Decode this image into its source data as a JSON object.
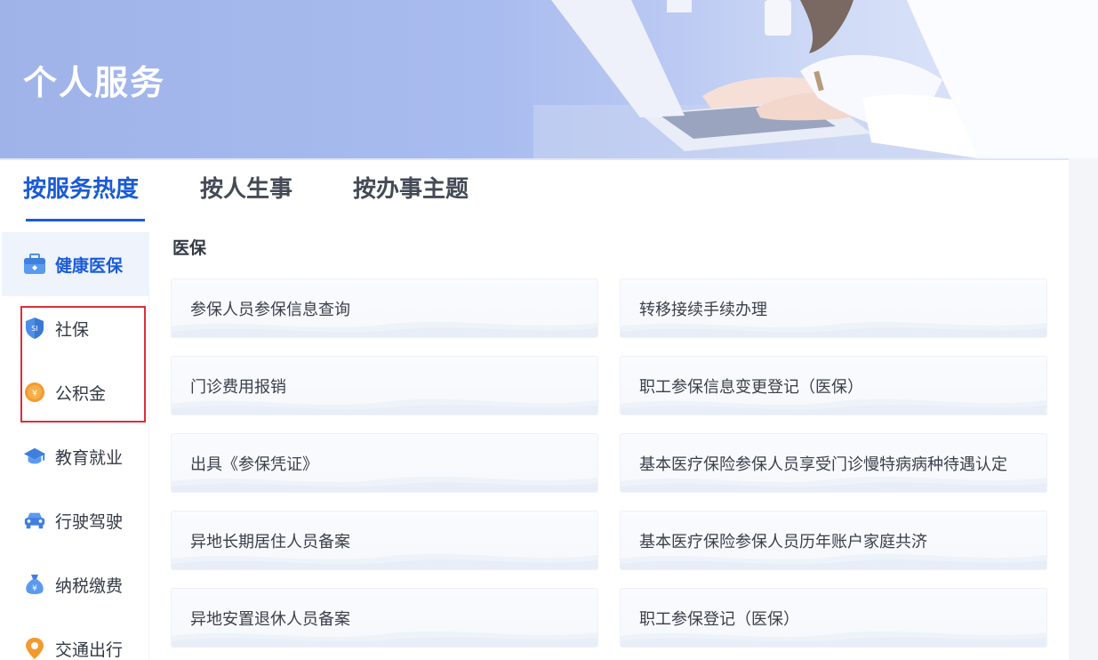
{
  "banner": {
    "title": "个人服务"
  },
  "tabs": [
    {
      "label": "按服务热度",
      "active": true
    },
    {
      "label": "按人生事",
      "active": false
    },
    {
      "label": "按办事主题",
      "active": false
    }
  ],
  "sidebar": {
    "items": [
      {
        "label": "健康医保",
        "icon": "medical-kit-icon",
        "active": true
      },
      {
        "label": "社保",
        "icon": "si-shield-icon",
        "active": false
      },
      {
        "label": "公积金",
        "icon": "yen-coin-icon",
        "active": false
      },
      {
        "label": "教育就业",
        "icon": "graduation-cap-icon",
        "active": false
      },
      {
        "label": "行驶驾驶",
        "icon": "car-icon",
        "active": false
      },
      {
        "label": "纳税缴费",
        "icon": "money-bag-icon",
        "active": false
      },
      {
        "label": "交通出行",
        "icon": "traffic-icon",
        "active": false
      }
    ]
  },
  "content": {
    "section_title": "医保",
    "services": [
      "参保人员参保信息查询",
      "转移接续手续办理",
      "门诊费用报销",
      "职工参保信息变更登记（医保）",
      "出具《参保凭证》",
      "基本医疗保险参保人员享受门诊慢特病病种待遇认定",
      "异地长期居住人员备案",
      "基本医疗保险参保人员历年账户家庭共济",
      "异地安置退休人员备案",
      "职工参保登记（医保）"
    ]
  },
  "colors": {
    "accent": "#1a5bd6",
    "highlight": "#d9303a"
  }
}
